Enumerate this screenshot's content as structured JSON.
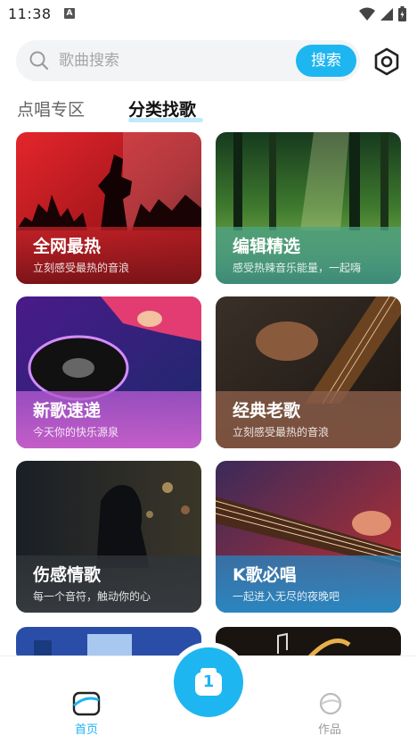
{
  "status_bar": {
    "time": "11:38",
    "notification_badge": "A"
  },
  "search": {
    "placeholder": "歌曲搜索",
    "button_label": "搜索"
  },
  "tabs": [
    {
      "label": "点唱专区",
      "active": false
    },
    {
      "label": "分类找歌",
      "active": true
    }
  ],
  "categories": [
    {
      "title": "全网最热",
      "subtitle": "立刻感受最热的音浪"
    },
    {
      "title": "编辑精选",
      "subtitle": "感受热辣音乐能量，一起嗨"
    },
    {
      "title": "新歌速递",
      "subtitle": "今天你的快乐源泉"
    },
    {
      "title": "经典老歌",
      "subtitle": "立刻感受最热的音浪"
    },
    {
      "title": "伤感情歌",
      "subtitle": "每一个音符，触动你的心"
    },
    {
      "title": "K歌必唱",
      "subtitle": "一起进入无尽的夜晚吧"
    }
  ],
  "bottom_nav": {
    "home_label": "首页",
    "works_label": "作品",
    "center_badge": "1"
  },
  "colors": {
    "accent": "#1eb6f0"
  }
}
